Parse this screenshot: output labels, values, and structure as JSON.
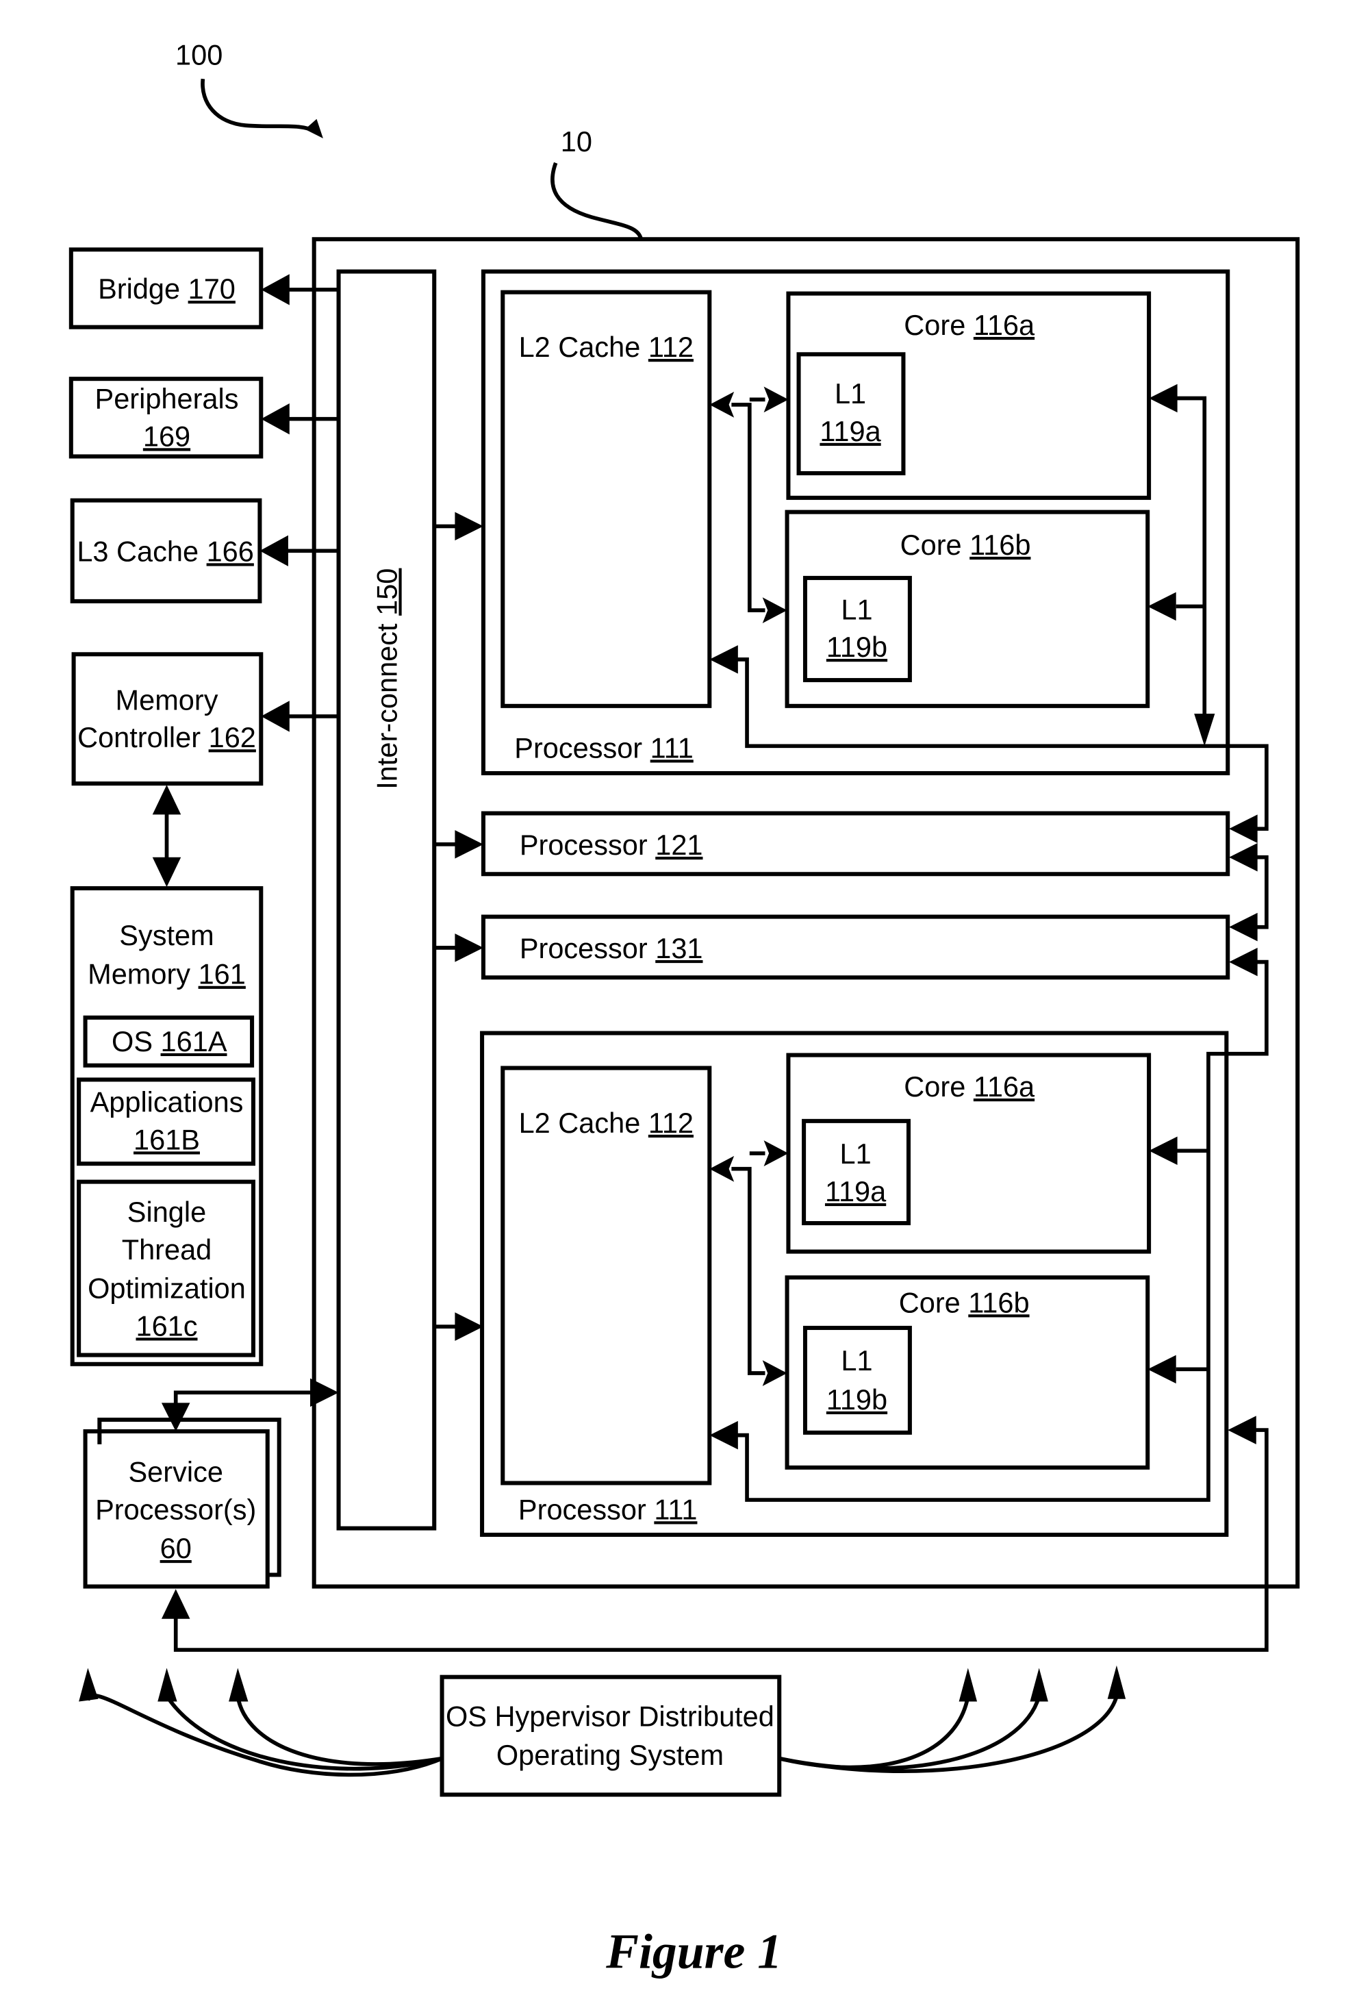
{
  "figure": {
    "caption": "Figure 1",
    "ref_system": "100",
    "ref_complex": "10"
  },
  "left_components": {
    "bridge": {
      "name": "Bridge",
      "ref": "170"
    },
    "peripherals": {
      "name": "Peripherals",
      "ref": "169"
    },
    "l3_cache": {
      "name": "L3 Cache",
      "ref": "166"
    },
    "memory_controller": {
      "line1": "Memory",
      "line2": "Controller",
      "ref": "162"
    },
    "system_memory": {
      "line1": "System",
      "line2": "Memory",
      "ref": "161",
      "os": {
        "name": "OS",
        "ref": "161A"
      },
      "applications": {
        "name": "Applications",
        "ref": "161B"
      },
      "single_thread": {
        "line1": "Single",
        "line2": "Thread",
        "line3": "Optimization",
        "ref": "161c"
      }
    },
    "service_processor": {
      "line1": "Service",
      "line2": "Processor(s)",
      "ref": "60"
    }
  },
  "interconnect": {
    "name": "Inter-connect",
    "ref": "150"
  },
  "processors": {
    "top": {
      "name": "Processor",
      "ref": "111",
      "l2": {
        "name": "L2 Cache",
        "ref": "112"
      },
      "core_a": {
        "name": "Core",
        "ref": "116a",
        "l1_name": "L1",
        "l1_ref": "119a"
      },
      "core_b": {
        "name": "Core",
        "ref": "116b",
        "l1_name": "L1",
        "l1_ref": "119b"
      }
    },
    "p121": {
      "name": "Processor",
      "ref": "121"
    },
    "p131": {
      "name": "Processor",
      "ref": "131"
    },
    "bottom": {
      "name": "Processor",
      "ref": "111",
      "l2": {
        "name": "L2 Cache",
        "ref": "112"
      },
      "core_a": {
        "name": "Core",
        "ref": "116a",
        "l1_name": "L1",
        "l1_ref": "119a"
      },
      "core_b": {
        "name": "Core",
        "ref": "116b",
        "l1_name": "L1",
        "l1_ref": "119b"
      }
    }
  },
  "hypervisor": {
    "line1": "OS Hypervisor Distributed",
    "line2": "Operating System"
  }
}
